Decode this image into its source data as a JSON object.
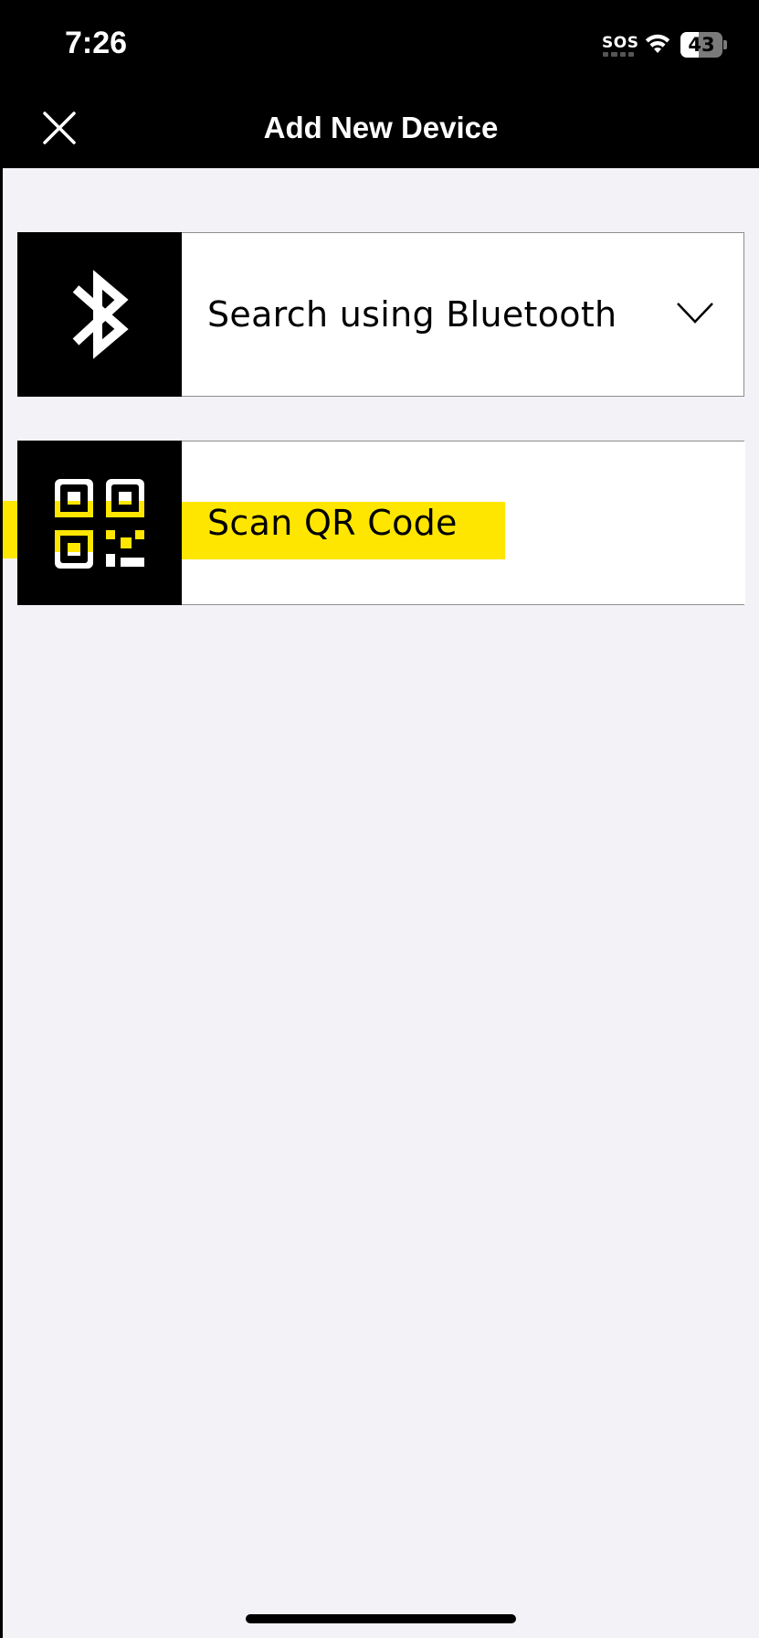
{
  "status_bar": {
    "time": "7:26",
    "sos": "SOS",
    "battery_level": 43,
    "battery_text": "43"
  },
  "nav": {
    "title": "Add New Device",
    "close_icon": "close-icon"
  },
  "options": [
    {
      "label": "Search using Bluetooth",
      "icon": "bluetooth-icon",
      "trailing_icon": "chevron-down-icon"
    },
    {
      "label": "Scan QR Code",
      "icon": "qr-code-icon"
    }
  ],
  "colors": {
    "accent_yellow": "#ffe600",
    "bar_black": "#000000",
    "background": "#f2f2f7"
  }
}
